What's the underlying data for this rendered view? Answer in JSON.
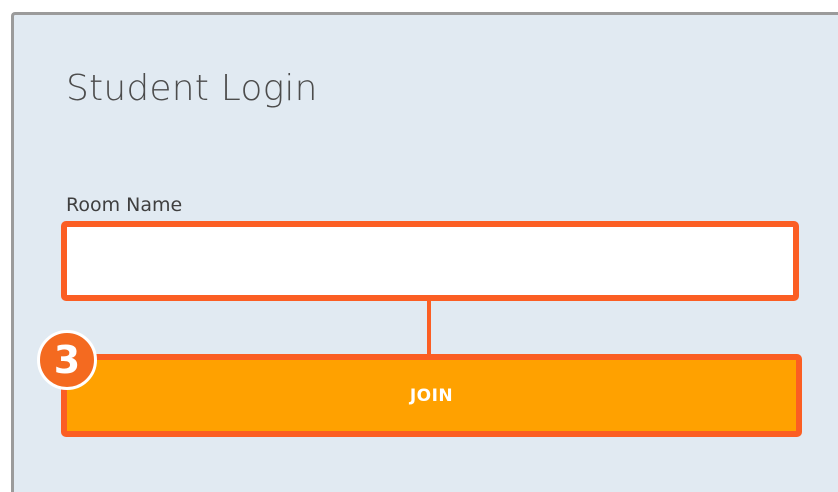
{
  "login": {
    "title": "Student Login",
    "room_name_label": "Room Name",
    "room_name_value": "",
    "room_name_placeholder": "",
    "join_label": "JOIN"
  },
  "annotation": {
    "step_number": "3"
  },
  "colors": {
    "panel_background": "#e1eaf2",
    "highlight_border": "#fb5e23",
    "join_button": "#ffa100",
    "step_badge": "#f46a20"
  }
}
